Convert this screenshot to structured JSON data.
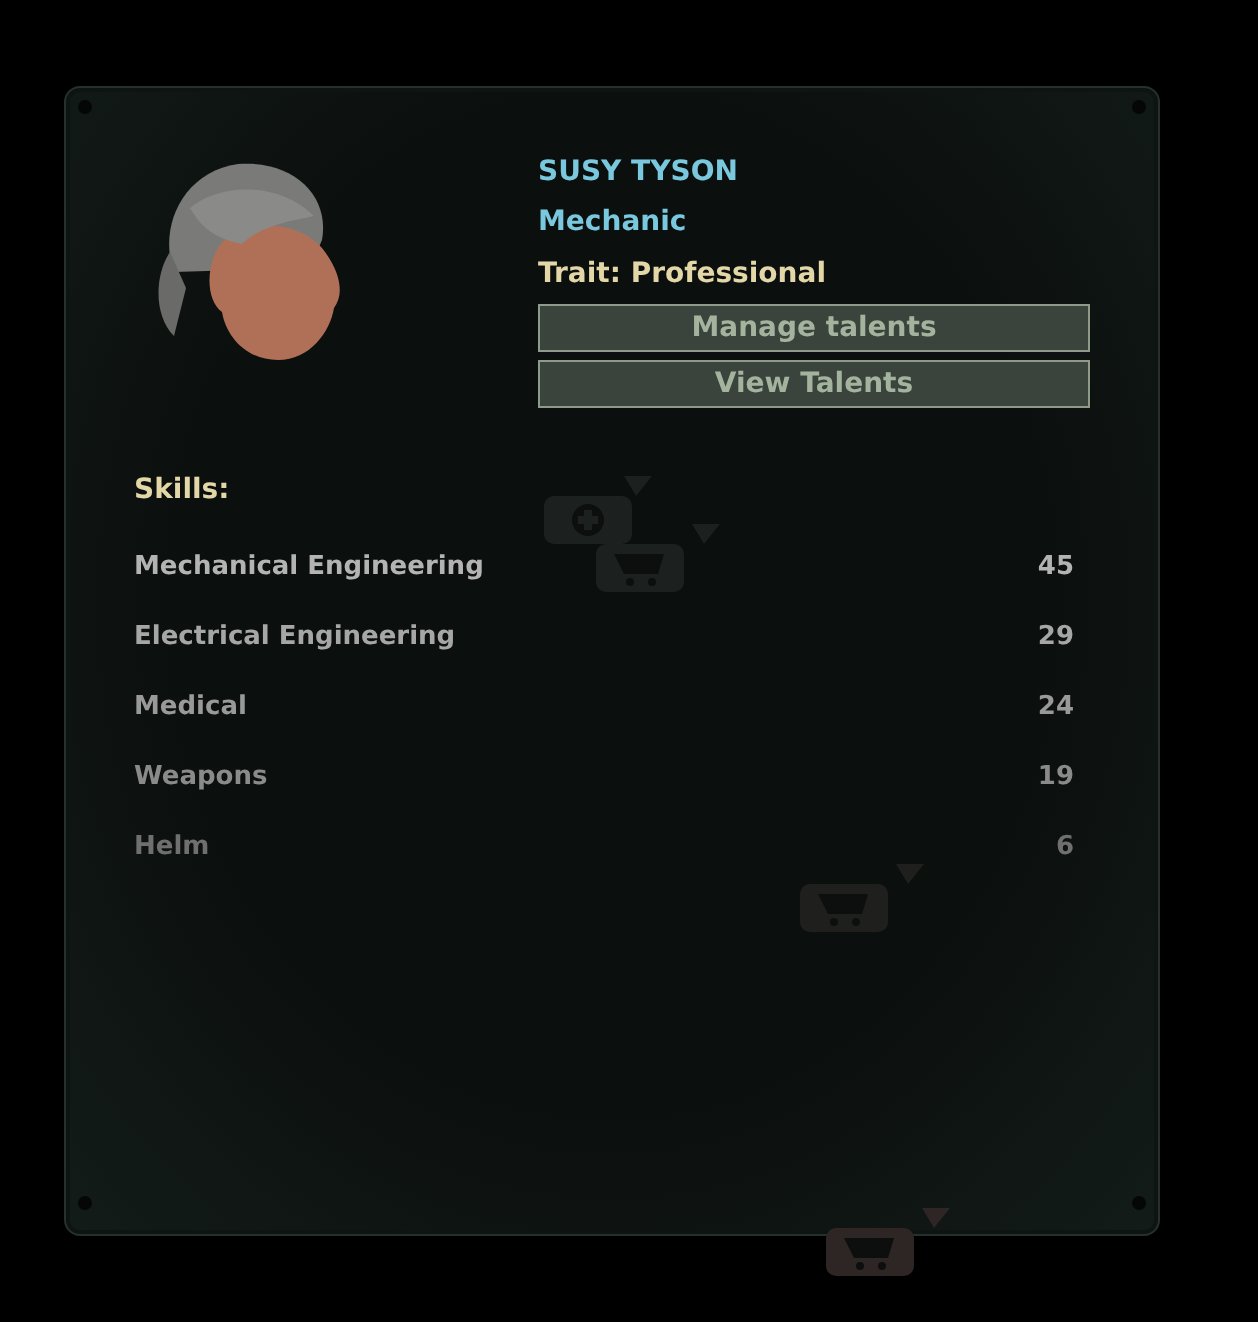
{
  "crew": {
    "name": "SUSY TYSON",
    "role": "Mechanic",
    "trait": "Trait: Professional"
  },
  "buttons": [
    "Manage talents",
    "View Talents"
  ],
  "skills_heading": "Skills:",
  "skills": [
    {
      "name": "Mechanical Engineering",
      "value": "45"
    },
    {
      "name": "Electrical Engineering",
      "value": "29"
    },
    {
      "name": "Medical",
      "value": "24"
    },
    {
      "name": "Weapons",
      "value": "19"
    },
    {
      "name": "Helm",
      "value": "6"
    }
  ],
  "markers": [
    {
      "kind": "medical"
    },
    {
      "kind": "cart"
    },
    {
      "kind": "cart"
    },
    {
      "kind": "cart"
    }
  ]
}
